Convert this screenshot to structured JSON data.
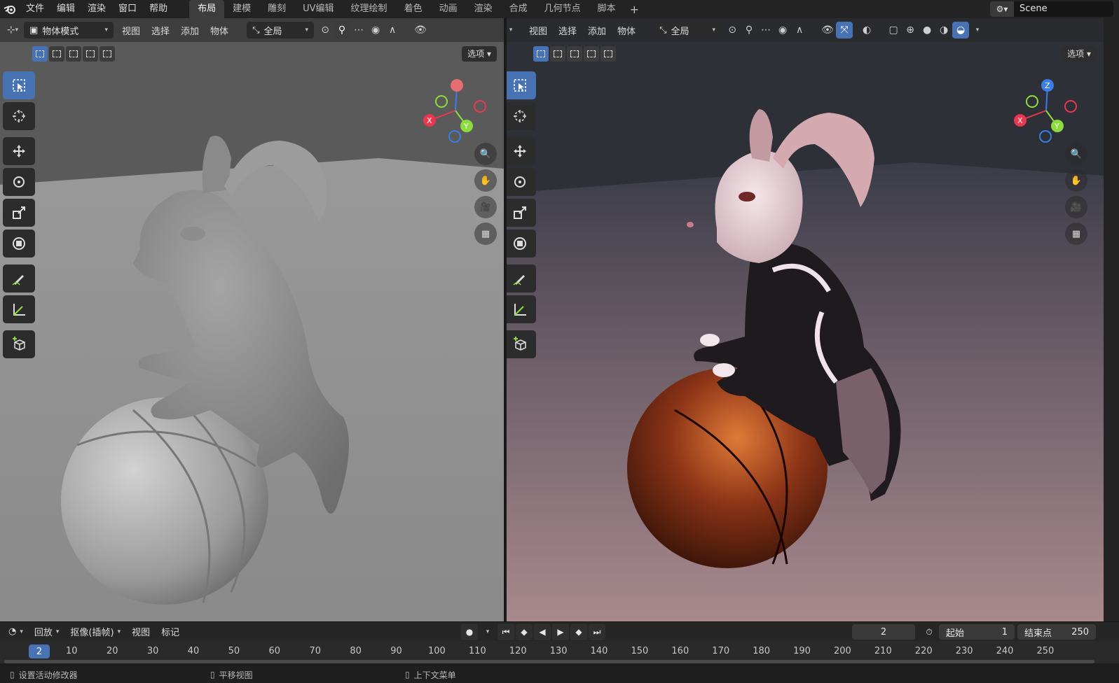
{
  "menu": {
    "file": "文件",
    "edit": "编辑",
    "render": "渲染",
    "window": "窗口",
    "help": "帮助"
  },
  "workspaces": [
    "布局",
    "建模",
    "雕刻",
    "UV编辑",
    "纹理绘制",
    "着色",
    "动画",
    "渲染",
    "合成",
    "几何节点",
    "脚本"
  ],
  "scene": {
    "name": "Scene"
  },
  "left_viewport": {
    "mode": "物体模式",
    "menus": [
      "视图",
      "选择",
      "添加",
      "物体"
    ],
    "transform_orientation": "全局",
    "options": "选项"
  },
  "right_viewport": {
    "menus": [
      "视图",
      "选择",
      "添加",
      "物体"
    ],
    "transform_orientation": "全局",
    "options": "选项"
  },
  "gizmo": {
    "x": "X",
    "y": "Y",
    "z": "Z"
  },
  "timeline": {
    "playback": "回放",
    "keying": "抠像(插帧)",
    "view": "视图",
    "marker": "标记",
    "current_frame": "2",
    "start_label": "起始",
    "start_value": "1",
    "end_label": "结束点",
    "end_value": "250",
    "ticks": [
      "10",
      "20",
      "30",
      "40",
      "50",
      "60",
      "70",
      "80",
      "90",
      "100",
      "110",
      "120",
      "130",
      "140",
      "150",
      "160",
      "170",
      "180",
      "190",
      "200",
      "210",
      "220",
      "230",
      "240",
      "250"
    ],
    "playhead": "2"
  },
  "statusbar": {
    "item1": "设置活动修改器",
    "item2": "平移视图",
    "item3": "上下文菜单"
  },
  "colors": {
    "accent": "#4772b3",
    "x_axis": "#e8384f",
    "y_axis": "#8bdc3c",
    "z_axis": "#3b7ee6"
  }
}
